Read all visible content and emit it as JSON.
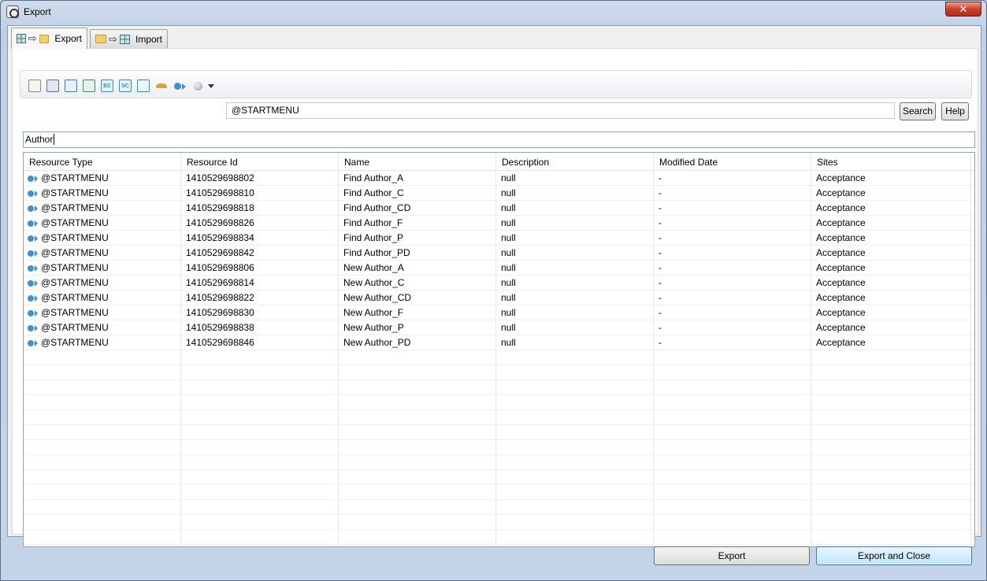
{
  "window": {
    "title": "Export",
    "close_label": "✕"
  },
  "tabs": [
    {
      "label": "Export",
      "active": true
    },
    {
      "label": "Import",
      "active": false
    }
  ],
  "toolbar": {
    "icons": [
      "document-icon",
      "database-icon",
      "grid-icon",
      "list-icon",
      "ec-icon",
      "sc-icon",
      "transfer-icon",
      "hat-icon",
      "startmenu-icon",
      "gray-ball-icon"
    ],
    "resource_type_value": "@STARTMENU",
    "search_label": "Search",
    "help_label": "Help"
  },
  "filter": {
    "value": "Author"
  },
  "table": {
    "columns": [
      "Resource Type",
      "Resource Id",
      "Name",
      "Description",
      "Modified Date",
      "Sites"
    ],
    "rows": [
      {
        "type": "@STARTMENU",
        "id": "1410529698802",
        "name": "Find Author_A",
        "description": "null",
        "modified": "-",
        "sites": "Acceptance"
      },
      {
        "type": "@STARTMENU",
        "id": "1410529698810",
        "name": "Find Author_C",
        "description": "null",
        "modified": "-",
        "sites": "Acceptance"
      },
      {
        "type": "@STARTMENU",
        "id": "1410529698818",
        "name": "Find Author_CD",
        "description": "null",
        "modified": "-",
        "sites": "Acceptance"
      },
      {
        "type": "@STARTMENU",
        "id": "1410529698826",
        "name": "Find Author_F",
        "description": "null",
        "modified": "-",
        "sites": "Acceptance"
      },
      {
        "type": "@STARTMENU",
        "id": "1410529698834",
        "name": "Find Author_P",
        "description": "null",
        "modified": "-",
        "sites": "Acceptance"
      },
      {
        "type": "@STARTMENU",
        "id": "1410529698842",
        "name": "Find Author_PD",
        "description": "null",
        "modified": "-",
        "sites": "Acceptance"
      },
      {
        "type": "@STARTMENU",
        "id": "1410529698806",
        "name": "New Author_A",
        "description": "null",
        "modified": "-",
        "sites": "Acceptance"
      },
      {
        "type": "@STARTMENU",
        "id": "1410529698814",
        "name": "New Author_C",
        "description": "null",
        "modified": "-",
        "sites": "Acceptance"
      },
      {
        "type": "@STARTMENU",
        "id": "1410529698822",
        "name": "New Author_CD",
        "description": "null",
        "modified": "-",
        "sites": "Acceptance"
      },
      {
        "type": "@STARTMENU",
        "id": "1410529698830",
        "name": "New Author_F",
        "description": "null",
        "modified": "-",
        "sites": "Acceptance"
      },
      {
        "type": "@STARTMENU",
        "id": "1410529698838",
        "name": "New Author_P",
        "description": "null",
        "modified": "-",
        "sites": "Acceptance"
      },
      {
        "type": "@STARTMENU",
        "id": "1410529698846",
        "name": "New Author_PD",
        "description": "null",
        "modified": "-",
        "sites": "Acceptance"
      }
    ]
  },
  "footer": {
    "export_label": "Export",
    "export_close_label": "Export and Close"
  }
}
